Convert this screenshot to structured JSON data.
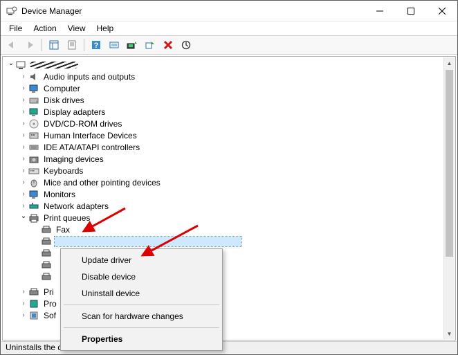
{
  "window": {
    "title": "Device Manager"
  },
  "menu": {
    "file": "File",
    "action": "Action",
    "view": "View",
    "help": "Help"
  },
  "tree": {
    "root": "Desktop",
    "items": {
      "audio": "Audio inputs and outputs",
      "computer": "Computer",
      "disk": "Disk drives",
      "display": "Display adapters",
      "dvd": "DVD/CD-ROM drives",
      "hid": "Human Interface Devices",
      "ide": "IDE ATA/ATAPI controllers",
      "imaging": "Imaging devices",
      "keyboards": "Keyboards",
      "mice": "Mice and other pointing devices",
      "monitors": "Monitors",
      "network": "Network adapters",
      "printq": "Print queues",
      "fax": "Fax",
      "pri": "Pri",
      "pro": "Pro",
      "sof": "Sof"
    }
  },
  "context_menu": {
    "update": "Update driver",
    "disable": "Disable device",
    "uninstall": "Uninstall device",
    "scan": "Scan for hardware changes",
    "properties": "Properties"
  },
  "status": "Uninstalls the driver for the selected device."
}
